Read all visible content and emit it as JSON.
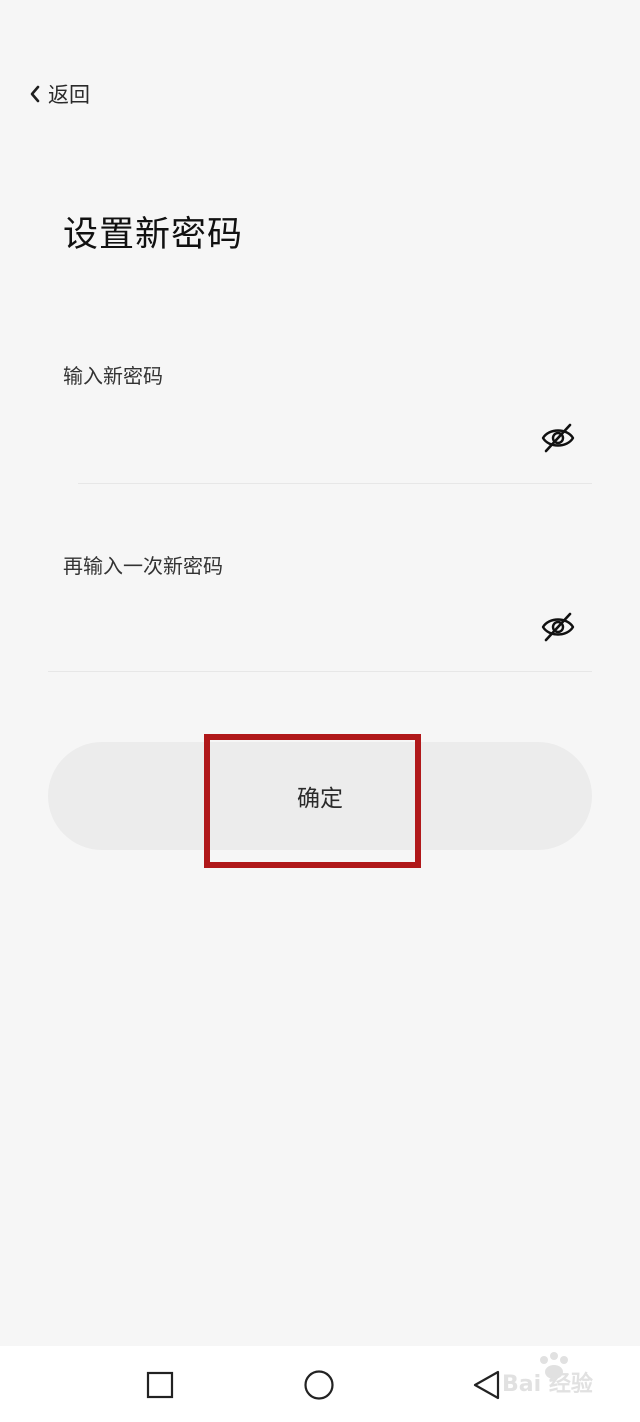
{
  "header": {
    "back_label": "返回"
  },
  "page": {
    "title": "设置新密码"
  },
  "form": {
    "new_password_label": "输入新密码",
    "new_password_value": "",
    "confirm_password_label": "再输入一次新密码",
    "confirm_password_value": ""
  },
  "actions": {
    "confirm_label": "确定"
  },
  "icons": {
    "back": "chevron-left-icon",
    "visibility_1": "eye-off-icon",
    "visibility_2": "eye-off-icon",
    "nav_recents": "square-icon",
    "nav_home": "circle-icon",
    "nav_back": "triangle-back-icon"
  },
  "watermark": {
    "text": "Bai 经验"
  },
  "colors": {
    "background": "#f6f6f6",
    "button_bg": "#ececec",
    "highlight": "#b0181a",
    "navbar_bg": "#ffffff"
  }
}
